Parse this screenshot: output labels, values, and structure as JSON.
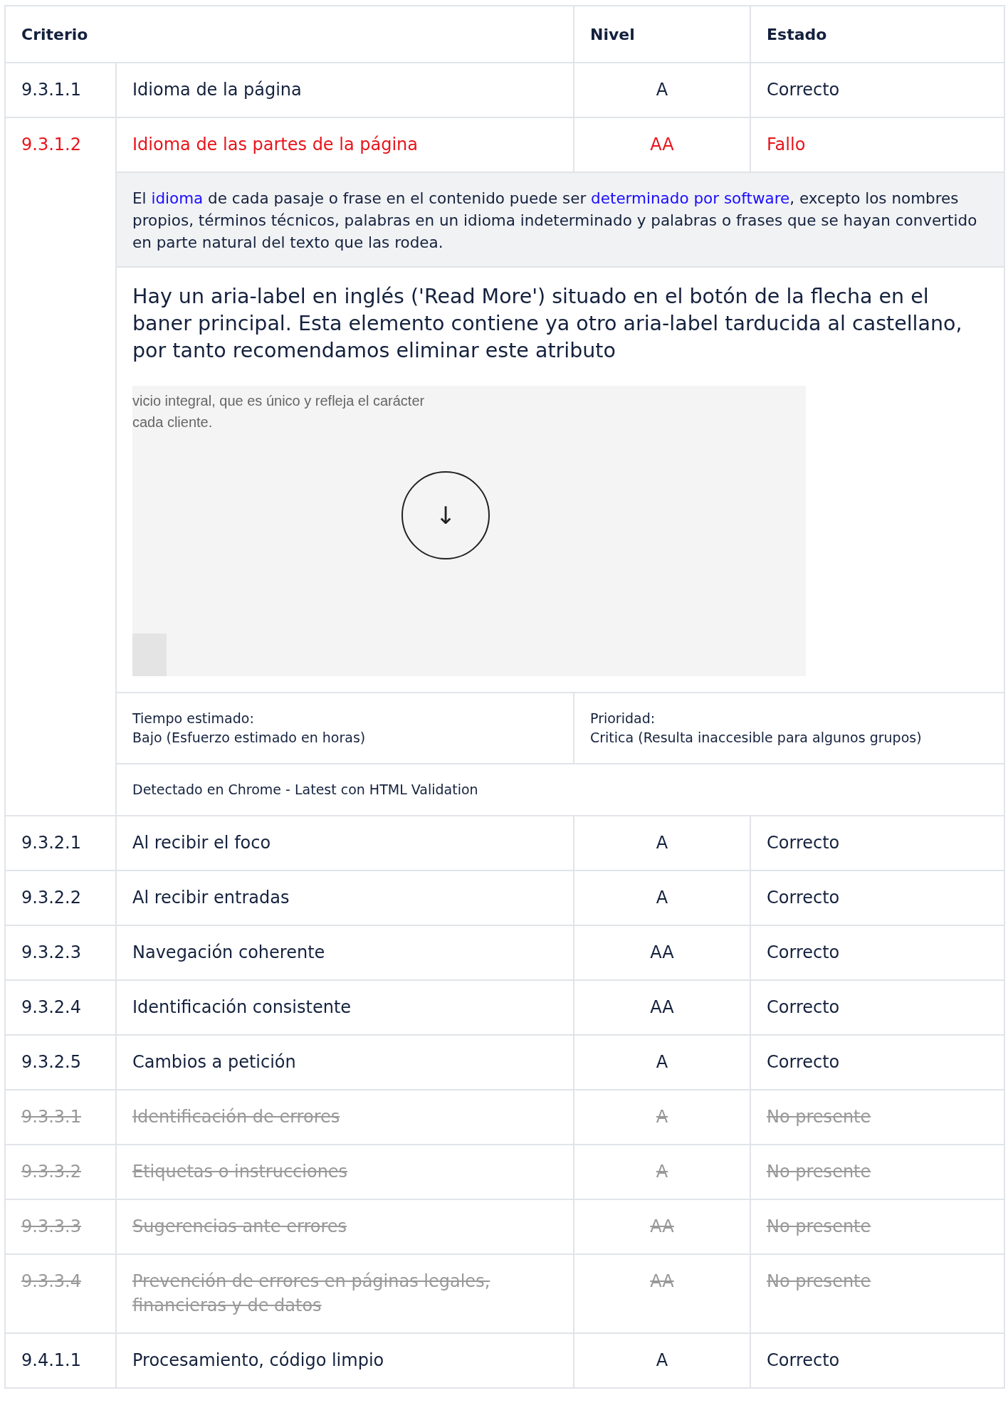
{
  "table": {
    "columns": [
      "Criterio",
      "Nivel",
      "Estado"
    ],
    "rows": [
      {
        "id": "9.3.1.1",
        "name": "Idioma de la página",
        "level": "A",
        "status": "Correcto",
        "kind": "pass"
      },
      {
        "id": "9.3.1.2",
        "name": "Idioma de las partes de la página",
        "level": "AA",
        "status": "Fallo",
        "kind": "fail",
        "details": {
          "definition": [
            {
              "text": "El ",
              "link": false
            },
            {
              "text": "idioma",
              "link": true
            },
            {
              "text": " de cada pasaje o frase en el contenido puede ser ",
              "link": false
            },
            {
              "text": "determinado por software",
              "link": true
            },
            {
              "text": ", excepto los nombres propios, términos técnicos, palabras en un idioma indeterminado y palabras o frases que se hayan convertido en parte natural del texto que las rodea.",
              "link": false
            }
          ],
          "comment": "Hay un aria-label en inglés ('Read More') situado en el botón de la flecha en el baner principal. Esta elemento contiene ya otro aria-label tarducida al castellano, por tanto recomendamos eliminar este atributo",
          "screenshot": {
            "lines": [
              "vicio integral, que es único y refleja el carácter",
              "cada cliente."
            ],
            "button": "↓"
          },
          "effort_label": "Tiempo estimado:",
          "effort": "Bajo (Esfuerzo estimado en horas)",
          "priority_label": "Prioridad:",
          "priority": "Critica (Resulta inaccesible para algunos grupos)",
          "detected": "Detectado en Chrome - Latest con HTML Validation"
        }
      },
      {
        "id": "9.3.2.1",
        "name": "Al recibir el foco",
        "level": "A",
        "status": "Correcto",
        "kind": "pass"
      },
      {
        "id": "9.3.2.2",
        "name": "Al recibir entradas",
        "level": "A",
        "status": "Correcto",
        "kind": "pass"
      },
      {
        "id": "9.3.2.3",
        "name": "Navegación coherente",
        "level": "AA",
        "status": "Correcto",
        "kind": "pass"
      },
      {
        "id": "9.3.2.4",
        "name": "Identificación consistente",
        "level": "AA",
        "status": "Correcto",
        "kind": "pass"
      },
      {
        "id": "9.3.2.5",
        "name": "Cambios a petición",
        "level": "A",
        "status": "Correcto",
        "kind": "pass"
      },
      {
        "id": "9.3.3.1",
        "name": "Identificación de errores",
        "level": "A",
        "status": "No presente",
        "kind": "absent"
      },
      {
        "id": "9.3.3.2",
        "name": "Etiquetas o instrucciones",
        "level": "A",
        "status": "No presente",
        "kind": "absent"
      },
      {
        "id": "9.3.3.3",
        "name": "Sugerencias ante errores",
        "level": "AA",
        "status": "No presente",
        "kind": "absent"
      },
      {
        "id": "9.3.3.4",
        "name": "Prevención de errores en páginas legales, financieras y de datos",
        "level": "AA",
        "status": "No presente",
        "kind": "absent"
      },
      {
        "id": "9.4.1.1",
        "name": "Procesamiento, código limpio",
        "level": "A",
        "status": "Correcto",
        "kind": "pass"
      }
    ]
  }
}
